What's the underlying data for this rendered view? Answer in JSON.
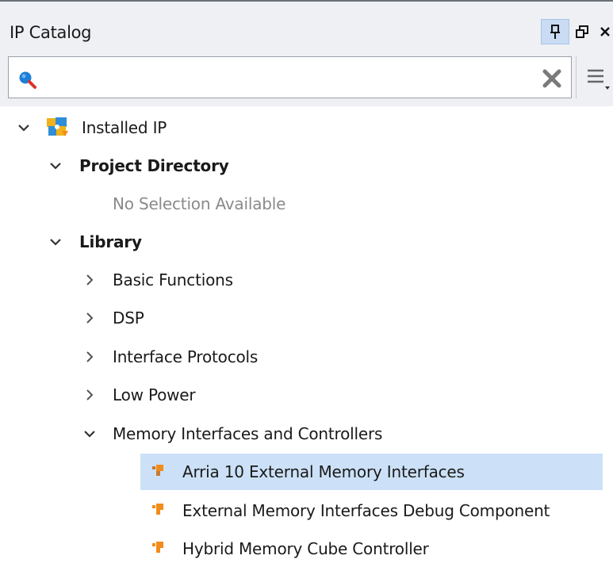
{
  "panel": {
    "title": "IP Catalog"
  },
  "search": {
    "value": "",
    "placeholder": ""
  },
  "tree": {
    "installed_ip": "Installed IP",
    "project_directory": "Project Directory",
    "no_selection": "No Selection Available",
    "library": "Library",
    "categories": [
      "Basic Functions",
      "DSP",
      "Interface Protocols",
      "Low Power",
      "Memory Interfaces and Controllers"
    ],
    "memory_items": [
      "Arria 10 External Memory Interfaces",
      "External Memory Interfaces Debug Component",
      "Hybrid Memory Cube Controller"
    ],
    "selected_item": "Arria 10 External Memory Interfaces"
  },
  "colors": {
    "selection": "#cce1f7",
    "ip_icon": "#f28c1a",
    "search_icon": "#1d7fd8",
    "header_bg": "#eef0f4"
  },
  "icons": {
    "pin": "pin-icon",
    "float": "float-window-icon",
    "close": "close-icon",
    "search": "search-icon",
    "clear": "clear-icon",
    "menu": "menu-icon",
    "installed": "installed-ip-icon",
    "ip": "ip-core-icon"
  }
}
